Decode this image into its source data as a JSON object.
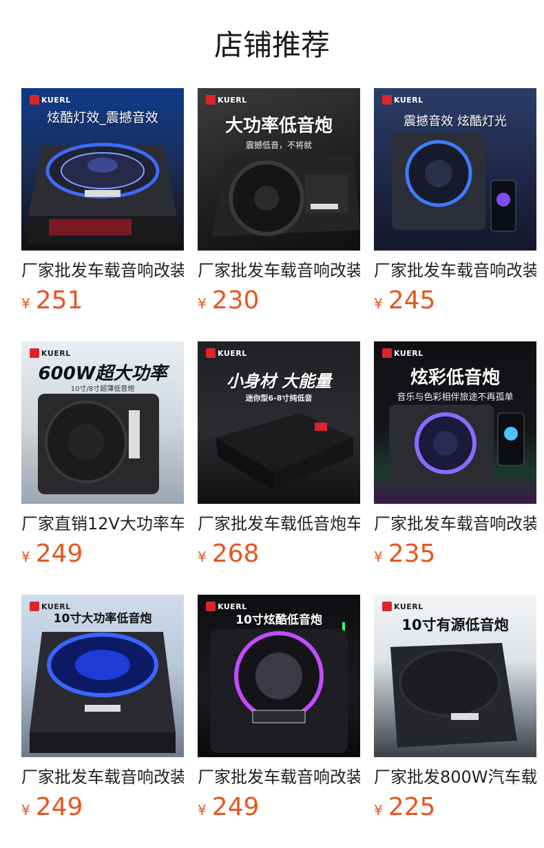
{
  "section": {
    "title": "店铺推荐"
  },
  "currency": "¥",
  "brand": "KUERL",
  "products": [
    {
      "title": "厂家批发车载音响改装",
      "price": "251",
      "image_text": "炫酷灯效_震撼音效",
      "image_subtext": ""
    },
    {
      "title": "厂家批发车载音响改装",
      "price": "230",
      "image_text": "大功率低音炮",
      "image_subtext": "震撼低音，不将就"
    },
    {
      "title": "厂家批发车载音响改装",
      "price": "245",
      "image_text": "震撼音效 炫酷灯光",
      "image_subtext": ""
    },
    {
      "title": "厂家直销12V大功率车",
      "price": "249",
      "image_text": "600W超大功率",
      "image_subtext": "10寸/8寸超薄低音炮"
    },
    {
      "title": "厂家批发车载低音炮车",
      "price": "268",
      "image_text": "小身材 大能量",
      "image_subtext": "迷你型6-8寸纯低音"
    },
    {
      "title": "厂家批发车载音响改装",
      "price": "235",
      "image_text": "炫彩低音炮",
      "image_subtext": "音乐与色彩相伴旅途不再孤单"
    },
    {
      "title": "厂家批发车载音响改装",
      "price": "249",
      "image_text": "10寸大功率低音炮",
      "image_subtext": ""
    },
    {
      "title": "厂家批发车载音响改装",
      "price": "249",
      "image_text": "10寸炫酷低音炮",
      "image_subtext": ""
    },
    {
      "title": "厂家批发800W汽车载",
      "price": "225",
      "image_text": "10寸有源低音炮",
      "image_subtext": ""
    }
  ]
}
